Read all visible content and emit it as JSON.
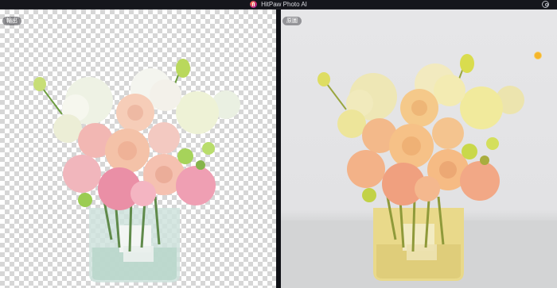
{
  "app": {
    "title": "HitPaw Photo AI"
  },
  "icons": {
    "logo": "hitpaw-logo-icon",
    "account": "account-icon"
  },
  "panes": {
    "output_label": "輸出",
    "original_label": "原圖"
  },
  "colors": {
    "titlebar": "#15161c",
    "divider": "#101116",
    "accent_dot": "#f5b52a"
  }
}
